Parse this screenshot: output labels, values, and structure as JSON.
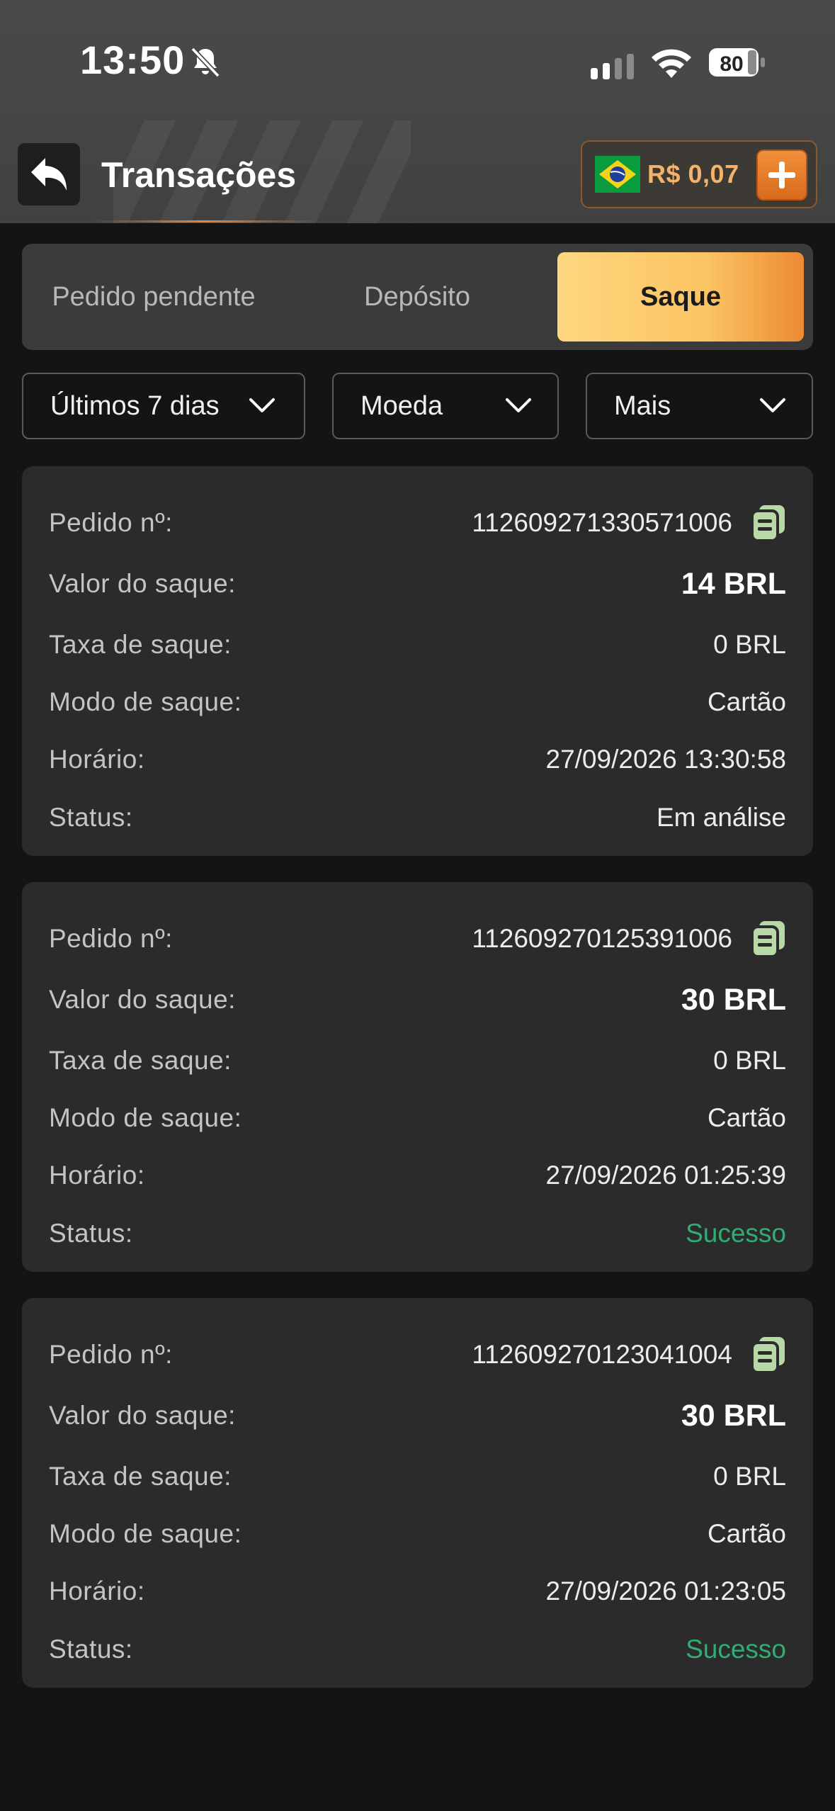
{
  "status_bar": {
    "time": "13:50",
    "battery": "80"
  },
  "header": {
    "title": "Transações",
    "balance": "R$ 0,07"
  },
  "tabs": [
    {
      "label": "Pedido pendente",
      "active": false
    },
    {
      "label": "Depósito",
      "active": false
    },
    {
      "label": "Saque",
      "active": true
    }
  ],
  "filters": [
    {
      "label": "Últimos 7 dias"
    },
    {
      "label": "Moeda"
    },
    {
      "label": "Mais"
    }
  ],
  "labels": {
    "order": "Pedido nº:",
    "amount": "Valor do saque:",
    "fee": "Taxa de saque:",
    "mode": "Modo de saque:",
    "time": "Horário:",
    "status": "Status:"
  },
  "transactions": [
    {
      "order": "112609271330571006",
      "amount": "14 BRL",
      "fee": "0 BRL",
      "mode": "Cartão",
      "time": "27/09/2026 13:30:58",
      "status": "Em análise"
    },
    {
      "order": "112609270125391006",
      "amount": "30 BRL",
      "fee": "0 BRL",
      "mode": "Cartão",
      "time": "27/09/2026 01:25:39",
      "status": "Sucesso"
    },
    {
      "order": "112609270123041004",
      "amount": "30 BRL",
      "fee": "0 BRL",
      "mode": "Cartão",
      "time": "27/09/2026 01:23:05",
      "status": "Sucesso"
    }
  ],
  "colors": {
    "accent": "#f0913a",
    "success": "#2fae74",
    "tab_active": "#fbc463"
  },
  "icons": [
    "bell-slash-icon",
    "signal-icon",
    "wifi-icon",
    "battery-icon",
    "back-arrow-icon",
    "brazil-flag-icon",
    "plus-icon",
    "chevron-down-icon",
    "copy-icon"
  ]
}
